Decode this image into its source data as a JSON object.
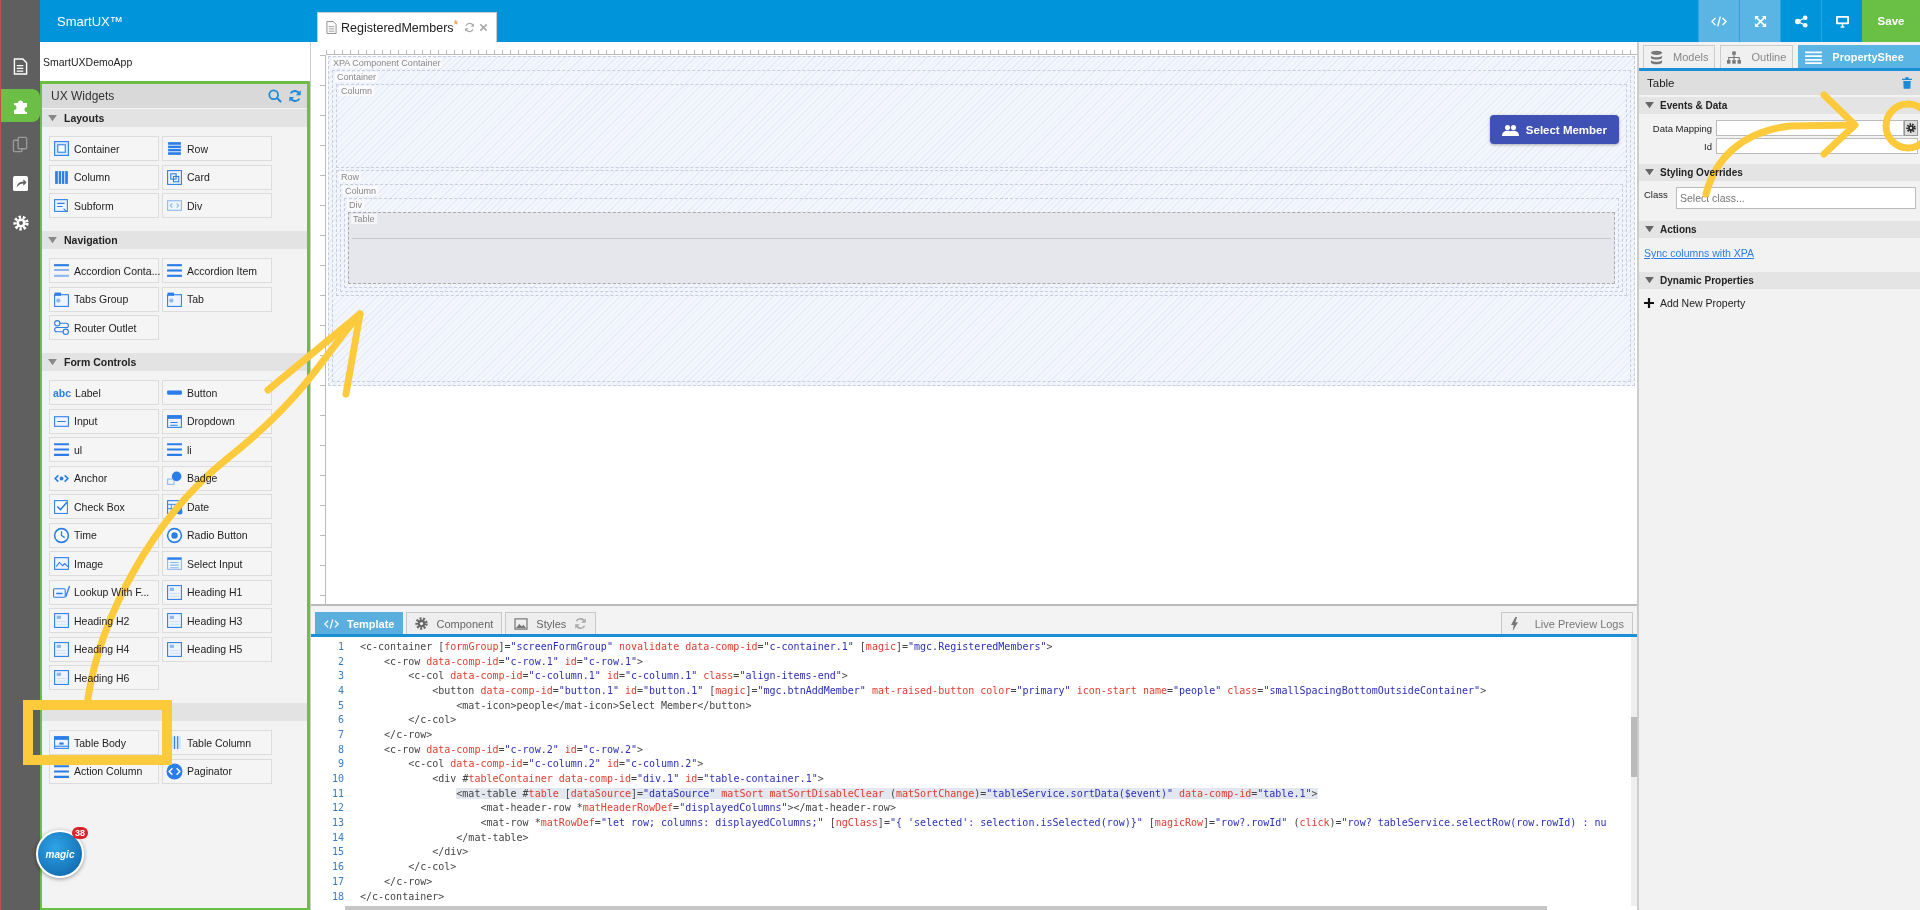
{
  "rail": [
    {
      "kind": "document",
      "selected": false
    },
    {
      "kind": "puzzle",
      "selected": true
    },
    {
      "kind": "copy",
      "selected": false
    },
    {
      "kind": "share",
      "selected": false
    },
    {
      "kind": "settings",
      "selected": false
    }
  ],
  "header": {
    "brand": "SmartUX™"
  },
  "document_tabs": [
    {
      "label": "RegisteredMembers",
      "dirty_mark": "*",
      "selected": true
    }
  ],
  "toolbar": [
    {
      "kind": "code",
      "selected": true
    },
    {
      "kind": "expand",
      "selected": true
    },
    {
      "kind": "share",
      "selected": false
    },
    {
      "kind": "monitor",
      "selected": false
    }
  ],
  "save_button": "Save",
  "widgets_panel": {
    "app_name": "SmartUXDemoApp",
    "title": "UX Widgets",
    "groups": [
      {
        "name": "Layouts",
        "expanded": true,
        "items": [
          {
            "label": "Container",
            "kind": "container"
          },
          {
            "label": "Row",
            "kind": "row"
          },
          {
            "label": "Column",
            "kind": "column"
          },
          {
            "label": "Card",
            "kind": "card"
          },
          {
            "label": "Subform",
            "kind": "subform"
          },
          {
            "label": "Div",
            "kind": "div"
          }
        ]
      },
      {
        "name": "Navigation",
        "expanded": true,
        "items": [
          {
            "label": "Accordion Conta...",
            "kind": "accordion"
          },
          {
            "label": "Accordion Item",
            "kind": "accordion-item"
          },
          {
            "label": "Tabs Group",
            "kind": "tabs"
          },
          {
            "label": "Tab",
            "kind": "tab"
          },
          {
            "label": "Router Outlet",
            "kind": "router"
          }
        ]
      },
      {
        "name": "Form Controls",
        "expanded": true,
        "items": [
          {
            "label": "Label",
            "kind": "glyph",
            "glyph": "abc"
          },
          {
            "label": "Button",
            "kind": "button"
          },
          {
            "label": "Input",
            "kind": "input"
          },
          {
            "label": "Dropdown",
            "kind": "dropdown"
          },
          {
            "label": "ul",
            "kind": "list"
          },
          {
            "label": "li",
            "kind": "list"
          },
          {
            "label": "Anchor",
            "kind": "anchor"
          },
          {
            "label": "Badge",
            "kind": "badge"
          },
          {
            "label": "Check Box",
            "kind": "checkbox"
          },
          {
            "label": "Date",
            "kind": "date"
          },
          {
            "label": "Time",
            "kind": "time"
          },
          {
            "label": "Radio Button",
            "kind": "radio"
          },
          {
            "label": "Image",
            "kind": "image"
          },
          {
            "label": "Select Input",
            "kind": "select"
          },
          {
            "label": "Lookup With F...",
            "kind": "lookup"
          },
          {
            "label": "Heading H1",
            "kind": "heading"
          },
          {
            "label": "Heading H2",
            "kind": "heading"
          },
          {
            "label": "Heading H3",
            "kind": "heading"
          },
          {
            "label": "Heading H4",
            "kind": "heading"
          },
          {
            "label": "Heading H5",
            "kind": "heading"
          },
          {
            "label": "Heading H6",
            "kind": "heading"
          }
        ]
      },
      {
        "items": [
          {
            "label": "Table Body",
            "kind": "table"
          },
          {
            "label": "Table Column",
            "kind": "table-column"
          },
          {
            "label": "Action Column",
            "kind": "action"
          },
          {
            "label": "Paginator",
            "kind": "paginator"
          }
        ]
      }
    ]
  },
  "magic_badge": {
    "logo": "magic",
    "count": "38"
  },
  "canvas": {
    "root": {
      "label": "XPA Component Container",
      "selected": false,
      "children": [
        {
          "label": "Container",
          "selected": false,
          "children": [
            {
              "label": "Column",
              "selected": false,
              "button": "Select Member"
            },
            {
              "label": "Row",
              "selected": false,
              "children": [
                {
                  "label": "Column",
                  "selected": false,
                  "children": [
                    {
                      "label": "Div",
                      "selected": false,
                      "children": [
                        {
                          "label": "Table",
                          "selected": true
                        }
                      ]
                    }
                  ]
                }
              ]
            }
          ]
        }
      ]
    }
  },
  "editor_tabs": [
    {
      "label": "Template",
      "kind": "code",
      "selected": true
    },
    {
      "label": "Component",
      "kind": "gear",
      "selected": false
    },
    {
      "label": "Styles",
      "kind": "styles",
      "selected": false
    }
  ],
  "live_preview_button": "Live Preview Logs",
  "code_lines": [
    {
      "number": "1",
      "text": "<c-container [formGroup]=\"screenFormGroup\" novalidate data-comp-id=\"c-container.1\" [magic]=\"mgc.RegisteredMembers\">",
      "highlighted": false
    },
    {
      "number": "2",
      "text": "    <c-row data-comp-id=\"c-row.1\" id=\"c-row.1\">",
      "highlighted": false
    },
    {
      "number": "3",
      "text": "        <c-col data-comp-id=\"c-column.1\" id=\"c-column.1\" class=\"align-items-end\">",
      "highlighted": false
    },
    {
      "number": "4",
      "text": "            <button data-comp-id=\"button.1\" id=\"button.1\" [magic]=\"mgc.btnAddMember\" mat-raised-button color=\"primary\" icon-start name=\"people\" class=\"smallSpacingBottomOutsideContainer\">",
      "highlighted": false
    },
    {
      "number": "5",
      "text": "                <mat-icon>people</mat-icon>Select Member</button>",
      "highlighted": false
    },
    {
      "number": "6",
      "text": "        </c-col>",
      "highlighted": false
    },
    {
      "number": "7",
      "text": "    </c-row>",
      "highlighted": false
    },
    {
      "number": "8",
      "text": "    <c-row data-comp-id=\"c-row.2\" id=\"c-row.2\">",
      "highlighted": false
    },
    {
      "number": "9",
      "text": "        <c-col data-comp-id=\"c-column.2\" id=\"c-column.2\">",
      "highlighted": false
    },
    {
      "number": "10",
      "text": "            <div #tableContainer data-comp-id=\"div.1\" id=\"table-container.1\">",
      "highlighted": false
    },
    {
      "number": "11",
      "text": "                <mat-table #table [dataSource]=\"dataSource\" matSort matSortDisableClear (matSortChange)=\"tableService.sortData($event)\" data-comp-id=\"table.1\">",
      "highlighted": true
    },
    {
      "number": "12",
      "text": "                    <mat-header-row *matHeaderRowDef=\"displayedColumns\"></mat-header-row>",
      "highlighted": false
    },
    {
      "number": "13",
      "text": "                    <mat-row *matRowDef=\"let row; columns: displayedColumns;\" [ngClass]=\"{ 'selected': selection.isSelected(row)}\" [magicRow]=\"row?.rowId\" (click)=\"row? tableService.selectRow(row.rowId) : nu",
      "highlighted": false
    },
    {
      "number": "14",
      "text": "                </mat-table>",
      "highlighted": false
    },
    {
      "number": "15",
      "text": "            </div>",
      "highlighted": false
    },
    {
      "number": "16",
      "text": "        </c-col>",
      "highlighted": false
    },
    {
      "number": "17",
      "text": "    </c-row>",
      "highlighted": false
    },
    {
      "number": "18",
      "text": "</c-container>",
      "highlighted": false
    }
  ],
  "property_panel": {
    "tabs": [
      {
        "label": "Models",
        "kind": "database",
        "selected": false
      },
      {
        "label": "Outline",
        "kind": "hierarchy",
        "selected": false
      },
      {
        "label": "PropertyShee",
        "kind": "list",
        "selected": true
      }
    ],
    "title": "Table",
    "sections": [
      {
        "title": "Events & Data",
        "expanded": true,
        "kind": "fields",
        "fields": [
          {
            "label": "Data Mapping",
            "kind": "mapping"
          },
          {
            "label": "Id",
            "kind": "text"
          }
        ]
      },
      {
        "title": "Styling Overrides",
        "expanded": true,
        "kind": "fields",
        "fields": [
          {
            "label": "Class",
            "kind": "select",
            "placeholder": "Select class..."
          }
        ]
      },
      {
        "title": "Actions",
        "expanded": true,
        "kind": "links",
        "links": [
          "Sync columns with XPA"
        ]
      },
      {
        "title": "Dynamic Properties",
        "expanded": true,
        "kind": "add",
        "action": "Add New Property"
      }
    ]
  }
}
